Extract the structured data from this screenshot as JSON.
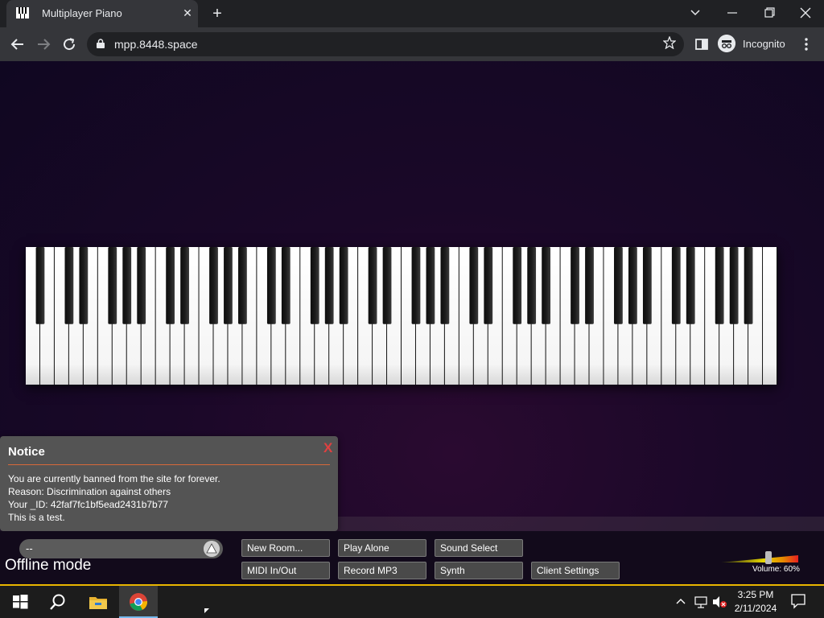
{
  "browser": {
    "tab_title": "Multiplayer Piano",
    "tab_close": "✕",
    "new_tab": "+",
    "url": "mpp.8448.space",
    "profile_label": "Incognito"
  },
  "piano": {
    "white_keys": 52,
    "colors": {
      "white_key": "#f5f5f5",
      "black_key": "#1b1b1b"
    }
  },
  "notice": {
    "title": "Notice",
    "close": "X",
    "lines": [
      "You are currently banned from the site for forever.",
      "Reason: Discrimination against others",
      "Your _ID: 42faf7fc1bf5ead2431b7b77",
      "This is a test."
    ]
  },
  "controls": {
    "room_value": "--",
    "status": "Offline mode",
    "buttons": {
      "new_room": "New Room...",
      "play_alone": "Play Alone",
      "sound_select": "Sound Select",
      "midi": "MIDI In/Out",
      "record": "Record MP3",
      "synth": "Synth",
      "client_settings": "Client Settings"
    },
    "volume": {
      "label": "Volume: 60%",
      "level": 0.6
    }
  },
  "taskbar": {
    "time": "3:25 PM",
    "date": "2/11/2024",
    "accent": "#e8b500"
  }
}
